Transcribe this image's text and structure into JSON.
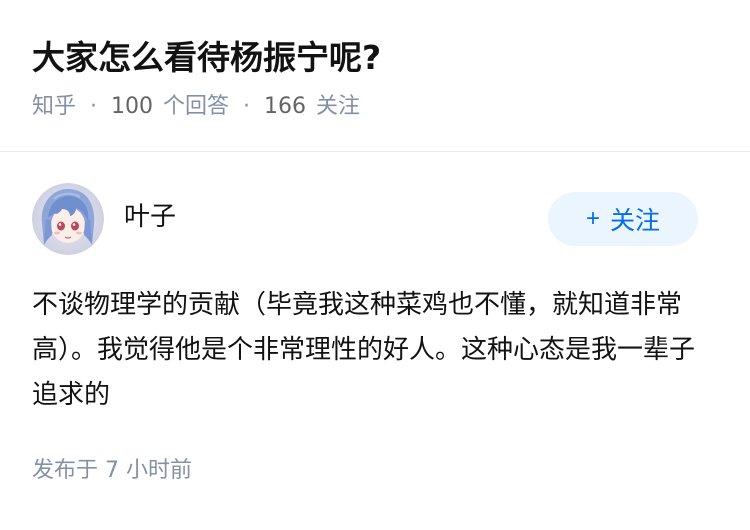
{
  "question": {
    "title": "大家怎么看待杨振宁呢?",
    "meta": {
      "source": "知乎",
      "answer_count": "100",
      "answer_label": "个回答",
      "follower_count": "166",
      "follower_label": "关注"
    }
  },
  "answer": {
    "author": {
      "name": "叶子",
      "follow_label": "关注",
      "follow_icon": "plus-icon"
    },
    "content": "不谈物理学的贡献（毕竟我这种菜鸡也不懂，就知道非常高）。我觉得他是个非常理性的好人。这种心态是我一辈子追求的",
    "publish_time": "发布于 7 小时前"
  },
  "colors": {
    "accent": "#056de8",
    "follow_bg": "#ebf5ff",
    "meta": "#8590a6",
    "text": "#121212"
  }
}
